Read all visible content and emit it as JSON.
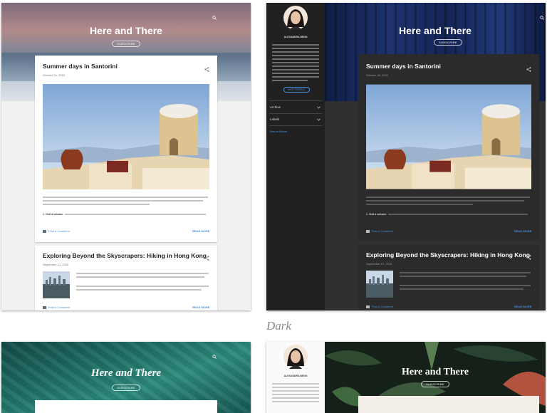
{
  "blog": {
    "title": "Here and There",
    "subscribe": "SUBSCRIBE",
    "theme_caption": "Dark"
  },
  "posts": [
    {
      "title": "Summer days in Santorini",
      "date": "October 16, 2016"
    },
    {
      "title": "Exploring Beyond the Skyscrapers: Hiking in Hong Kong",
      "date": "September 12, 2016"
    }
  ],
  "post_excerpt": {
    "tip_label": "1. Visit a volcano"
  },
  "footer": {
    "comment": "Post a Comment",
    "read_more": "READ MORE"
  },
  "sidebar": {
    "author_name": "ALEXANDRA BENN",
    "contact_button": "VISIT PROFILE",
    "archive": "Archive",
    "labels": "Labels",
    "report_abuse": "Report Abuse"
  },
  "colors": {
    "dark_bg": "#212121",
    "dark_card": "#2b2b2b",
    "link_blue": "#4a90d9",
    "teal_hero": "#1f6f63",
    "sunset_top": "#8d6f7c"
  },
  "icons": [
    "search-icon",
    "share-icon",
    "comment-icon",
    "chevron-down-icon"
  ]
}
